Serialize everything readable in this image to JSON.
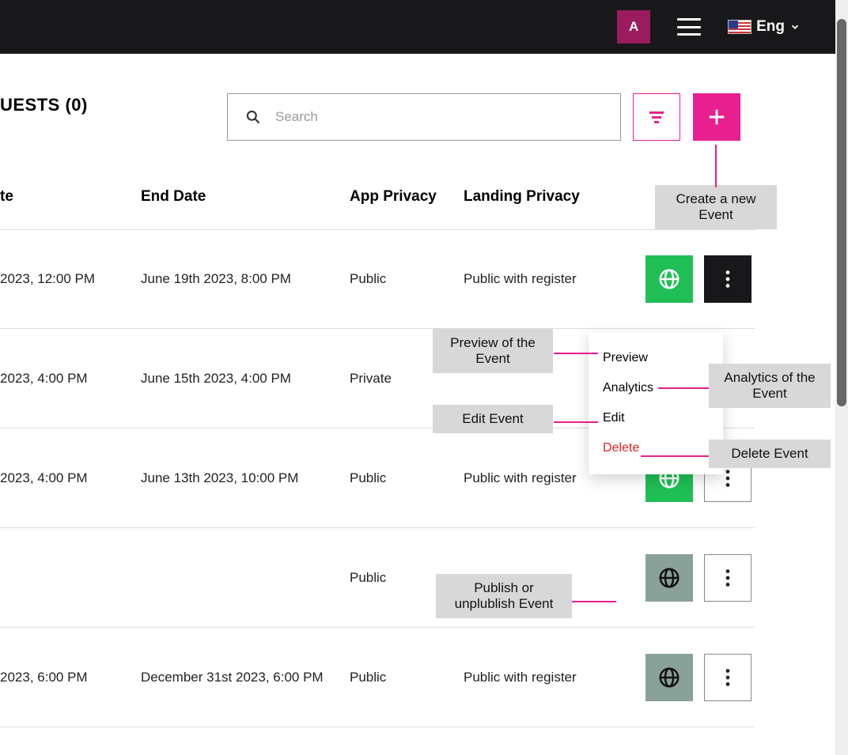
{
  "header": {
    "avatar_initial": "A",
    "lang_label": "Eng"
  },
  "actions": {
    "tab_fragment": "UESTS (0)",
    "search_placeholder": "Search"
  },
  "columns": {
    "start": "te",
    "end": "End Date",
    "app": "App Privacy",
    "landing": "Landing Privacy"
  },
  "rows": [
    {
      "start": " 2023, 12:00 PM",
      "end": "June 19th 2023, 8:00 PM",
      "app": "Public",
      "landing": "Public with register",
      "globe": "green",
      "more": "dark"
    },
    {
      "start": " 2023, 4:00 PM",
      "end": "June 15th 2023, 4:00 PM",
      "app": "Private",
      "landing": "",
      "globe": "",
      "more": ""
    },
    {
      "start": " 2023, 4:00 PM",
      "end": "June 13th 2023, 10:00 PM",
      "app": "Public",
      "landing": "Public with register",
      "globe": "green",
      "more": "light"
    },
    {
      "start": "",
      "end": "",
      "app": "Public",
      "landing": "",
      "globe": "grey",
      "more": "light"
    },
    {
      "start": "2023, 6:00 PM",
      "end": "December 31st 2023, 6:00 PM",
      "app": "Public",
      "landing": "Public with register",
      "globe": "grey",
      "more": "light"
    }
  ],
  "menu": {
    "preview": "Preview",
    "analytics": "Analytics",
    "edit": "Edit",
    "delete": "Delete"
  },
  "tips": {
    "create": "Create a new Event",
    "preview": "Preview of the Event",
    "analytics": "Analytics of the Event",
    "edit": "Edit Event",
    "delete": "Delete  Event",
    "publish": "Publish or unplublish Event"
  }
}
